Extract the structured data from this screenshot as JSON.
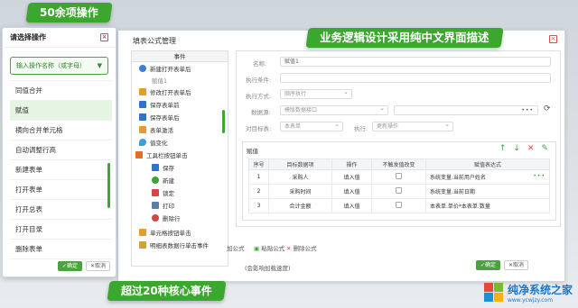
{
  "callouts": {
    "operations": "50余项操作",
    "business_logic": "业务逻辑设计采用纯中文界面描述",
    "events": "超过20种核心事件"
  },
  "operation_panel": {
    "title": "请选择操作",
    "select_placeholder": "输入操作名称（或字母）",
    "items": [
      "同值合并",
      "赋值",
      "横向合并单元格",
      "自动调整行高",
      "新建表单",
      "打开表单",
      "打开总表",
      "打开目录",
      "删除表单"
    ],
    "active_index": 1,
    "ok_label": "确定",
    "cancel_label": "取消"
  },
  "main": {
    "title": "填表公式管理",
    "events_header": "事件",
    "events": [
      {
        "label": "新建打开表单后",
        "icon": "person-icon"
      },
      {
        "label": "赋值1",
        "icon": ""
      },
      {
        "label": "修改打开表单后",
        "icon": "edit-doc-icon"
      },
      {
        "label": "保存表单前",
        "icon": "save-icon"
      },
      {
        "label": "保存表单后",
        "icon": "save-icon"
      },
      {
        "label": "表单激活",
        "icon": "doc-icon"
      },
      {
        "label": "值变化",
        "icon": "drop-icon"
      },
      {
        "label": "工具栏按钮单击",
        "icon": "tools-icon"
      },
      {
        "label": "保存",
        "icon": "save-icon"
      },
      {
        "label": "新建",
        "icon": "plus-icon"
      },
      {
        "label": "锁定",
        "icon": "lock-icon"
      },
      {
        "label": "打印",
        "icon": "print-icon"
      },
      {
        "label": "删除行",
        "icon": "delete-icon"
      },
      {
        "label": "单元格按钮单击",
        "icon": "doc-icon"
      },
      {
        "label": "明细表数据行单击事件",
        "icon": "note-icon"
      }
    ],
    "form": {
      "name_label": "名称:",
      "name_value": "赋值1",
      "condition_label": "执行条件:",
      "mode_label": "执行方式:",
      "mode_value": "顺序执行",
      "source_label": "数据源:",
      "source_value": "模版数据接口",
      "target_label": "对目标表:",
      "target_value": "本表单",
      "exec_label": "执行:",
      "exec_value": "更新操作"
    },
    "grid": {
      "title": "赋值",
      "headers": [
        "序号",
        "目标数据项",
        "操作",
        "不触发值改变",
        "赋值表达式"
      ],
      "rows": [
        {
          "no": "1",
          "target": "采购人",
          "op": "填入值",
          "expr": "系统变量.当前用户姓名"
        },
        {
          "no": "2",
          "target": "采购时间",
          "op": "填入值",
          "expr": "系统变量.当前日期"
        },
        {
          "no": "3",
          "target": "合计金额",
          "op": "填入值",
          "expr": "本表单.单价*本表单.数量"
        }
      ]
    },
    "bottom": {
      "left": "加公式",
      "paste": "粘贴公式",
      "delete": "删除公式",
      "note": "(会影响加载速度)"
    },
    "ok_label": "确定",
    "cancel_label": "取消"
  },
  "watermark": {
    "name": "纯净系统之家",
    "url": "www.ycwjzy.com"
  }
}
